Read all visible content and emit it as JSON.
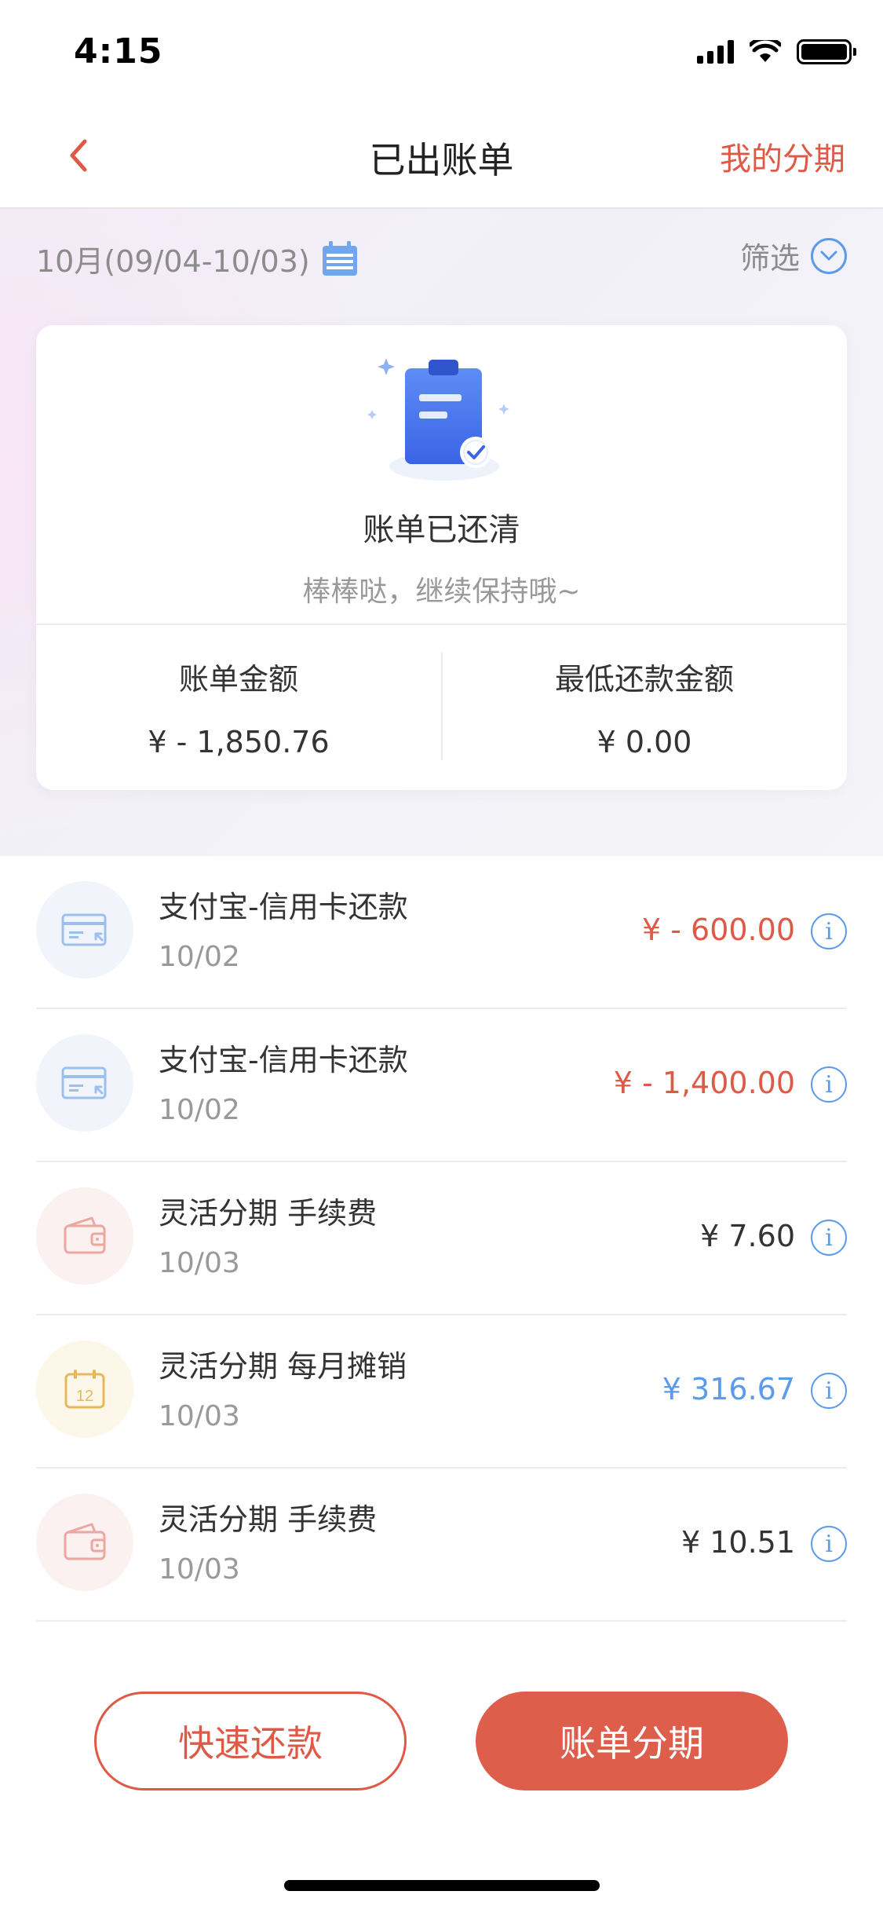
{
  "status_bar": {
    "time": "4:15"
  },
  "nav": {
    "title": "已出账单",
    "right_link": "我的分期",
    "back_icon": "chevron-left-icon"
  },
  "summary": {
    "period": "10月(09/04-10/03)",
    "filter_label": "筛选",
    "card": {
      "title": "账单已还清",
      "subtitle": "棒棒哒，继续保持哦~",
      "bill_amount_label": "账单金额",
      "bill_amount": "¥ - 1,850.76",
      "min_payment_label": "最低还款金额",
      "min_payment": "¥  0.00"
    }
  },
  "transactions": [
    {
      "title": "支付宝-信用卡还款",
      "date": "10/02",
      "amount": "¥ - 600.00",
      "icon": "credit-card-icon"
    },
    {
      "title": "支付宝-信用卡还款",
      "date": "10/02",
      "amount": "¥ - 1,400.00",
      "icon": "credit-card-icon"
    },
    {
      "title": "灵活分期 手续费",
      "date": "10/03",
      "amount": "¥  7.60",
      "icon": "wallet-icon"
    },
    {
      "title": "灵活分期 每月摊销",
      "date": "10/03",
      "amount": "¥  316.67",
      "icon": "calendar-icon",
      "calendar_day": "12"
    },
    {
      "title": "灵活分期 手续费",
      "date": "10/03",
      "amount": "¥  10.51",
      "icon": "wallet-icon"
    }
  ],
  "buttons": {
    "quick_pay": "快速还款",
    "installment": "账单分期"
  },
  "colors": {
    "accent": "#de5a46",
    "link_blue": "#5b9bea",
    "amount_dark": "#333333"
  }
}
